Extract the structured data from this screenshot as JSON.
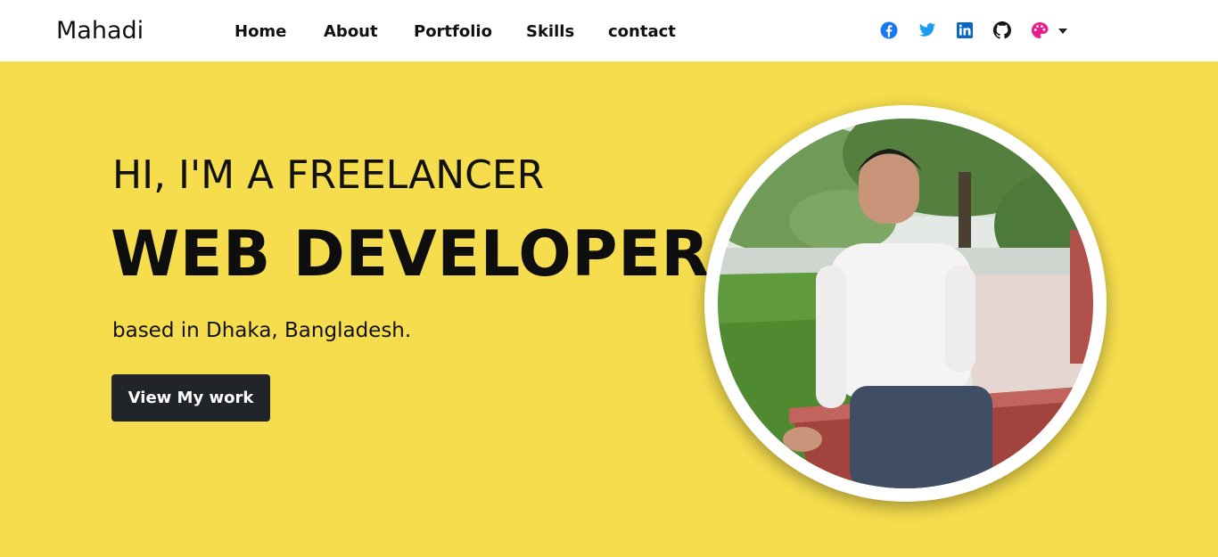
{
  "nav": {
    "brand": "Mahadi",
    "links": [
      "Home",
      "About",
      "Portfolio",
      "Skills",
      "contact"
    ]
  },
  "social": {
    "icons": [
      "facebook-icon",
      "twitter-icon",
      "linkedin-icon",
      "github-icon",
      "palette-icon",
      "caret-down-icon"
    ]
  },
  "hero": {
    "intro": "HI, I'M A FREELANCER",
    "title": "WEB DEVELOPER",
    "location": "based in Dhaka, Bangladesh.",
    "cta_label": "View My work"
  },
  "colors": {
    "hero_background": "#f5dd4d",
    "button_background": "#212529",
    "facebook": "#1877f2",
    "twitter": "#1d9bf0",
    "linkedin": "#0a66c2",
    "github": "#181717",
    "palette": "#e91e8c"
  }
}
